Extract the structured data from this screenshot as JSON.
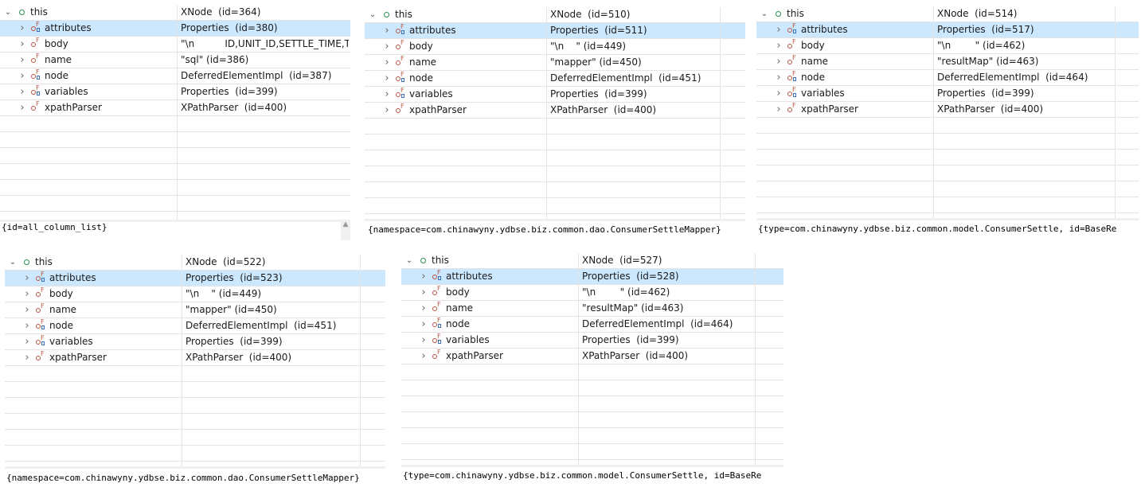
{
  "panels": [
    {
      "rows": [
        {
          "name": "this",
          "value": "XNode  (id=364)",
          "kind": "root",
          "expanded": true
        },
        {
          "name": "attributes",
          "value": "Properties  (id=380)",
          "kind": "props",
          "selected": true
        },
        {
          "name": "body",
          "value": "\"\\n          ID,UNIT_ID,SETTLE_TIME,TI...",
          "kind": "field"
        },
        {
          "name": "name",
          "value": "\"sql\" (id=386)",
          "kind": "field"
        },
        {
          "name": "node",
          "value": "DeferredElementImpl  (id=387)",
          "kind": "props"
        },
        {
          "name": "variables",
          "value": "Properties  (id=399)",
          "kind": "props"
        },
        {
          "name": "xpathParser",
          "value": "XPathParser  (id=400)",
          "kind": "field"
        }
      ],
      "detail": "{id=all_column_list}"
    },
    {
      "rows": [
        {
          "name": "this",
          "value": "XNode  (id=510)",
          "kind": "root",
          "expanded": true
        },
        {
          "name": "attributes",
          "value": "Properties  (id=511)",
          "kind": "props",
          "selected": true
        },
        {
          "name": "body",
          "value": "\"\\n    \" (id=449)",
          "kind": "field"
        },
        {
          "name": "name",
          "value": "\"mapper\" (id=450)",
          "kind": "field"
        },
        {
          "name": "node",
          "value": "DeferredElementImpl  (id=451)",
          "kind": "props"
        },
        {
          "name": "variables",
          "value": "Properties  (id=399)",
          "kind": "props"
        },
        {
          "name": "xpathParser",
          "value": "XPathParser  (id=400)",
          "kind": "field"
        }
      ],
      "detail": "{namespace=com.chinawyny.ydbse.biz.common.dao.ConsumerSettleMapper}"
    },
    {
      "rows": [
        {
          "name": "this",
          "value": "XNode  (id=514)",
          "kind": "root",
          "expanded": true
        },
        {
          "name": "attributes",
          "value": "Properties  (id=517)",
          "kind": "props",
          "selected": true
        },
        {
          "name": "body",
          "value": "\"\\n        \" (id=462)",
          "kind": "field"
        },
        {
          "name": "name",
          "value": "\"resultMap\" (id=463)",
          "kind": "field"
        },
        {
          "name": "node",
          "value": "DeferredElementImpl  (id=464)",
          "kind": "props"
        },
        {
          "name": "variables",
          "value": "Properties  (id=399)",
          "kind": "props"
        },
        {
          "name": "xpathParser",
          "value": "XPathParser  (id=400)",
          "kind": "field"
        }
      ],
      "detail": "{type=com.chinawyny.ydbse.biz.common.model.ConsumerSettle, id=BaseRe"
    },
    {
      "rows": [
        {
          "name": "this",
          "value": "XNode  (id=522)",
          "kind": "root",
          "expanded": true
        },
        {
          "name": "attributes",
          "value": "Properties  (id=523)",
          "kind": "props",
          "selected": true
        },
        {
          "name": "body",
          "value": "\"\\n    \" (id=449)",
          "kind": "field"
        },
        {
          "name": "name",
          "value": "\"mapper\" (id=450)",
          "kind": "field"
        },
        {
          "name": "node",
          "value": "DeferredElementImpl  (id=451)",
          "kind": "props"
        },
        {
          "name": "variables",
          "value": "Properties  (id=399)",
          "kind": "props"
        },
        {
          "name": "xpathParser",
          "value": "XPathParser  (id=400)",
          "kind": "field"
        }
      ],
      "detail": "{namespace=com.chinawyny.ydbse.biz.common.dao.ConsumerSettleMapper}"
    },
    {
      "rows": [
        {
          "name": "this",
          "value": "XNode  (id=527)",
          "kind": "root",
          "expanded": true
        },
        {
          "name": "attributes",
          "value": "Properties  (id=528)",
          "kind": "props",
          "selected": true
        },
        {
          "name": "body",
          "value": "\"\\n        \" (id=462)",
          "kind": "field"
        },
        {
          "name": "name",
          "value": "\"resultMap\" (id=463)",
          "kind": "field"
        },
        {
          "name": "node",
          "value": "DeferredElementImpl  (id=464)",
          "kind": "props"
        },
        {
          "name": "variables",
          "value": "Properties  (id=399)",
          "kind": "props"
        },
        {
          "name": "xpathParser",
          "value": "XPathParser  (id=400)",
          "kind": "field"
        }
      ],
      "detail": "{type=com.chinawyny.ydbse.biz.common.model.ConsumerSettle, id=BaseRe"
    }
  ],
  "icons": {
    "expanded": "chevron-down-icon",
    "collapsed": "chevron-right-icon",
    "root": "local-variable-icon",
    "field": "field-icon",
    "props": "field-with-subtype-icon",
    "scroll_up": "scroll-up-arrow-icon"
  },
  "colors": {
    "selection": "#cce8ff",
    "grid_line": "#e4e4e4",
    "field_icon": "#b9543d",
    "root_icon": "#2d8f4e"
  }
}
